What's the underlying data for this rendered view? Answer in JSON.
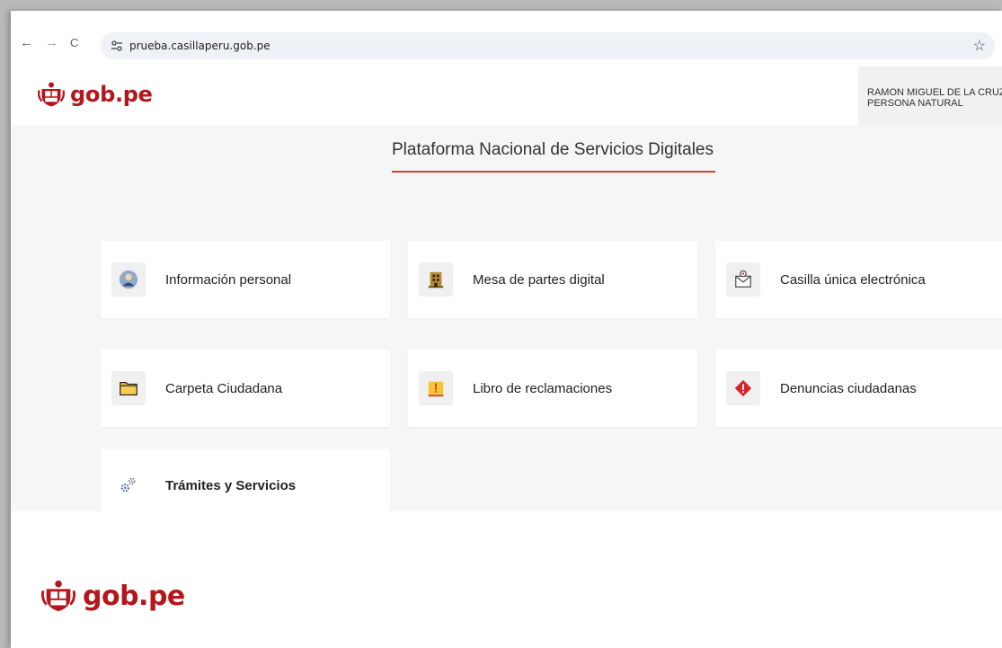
{
  "browser": {
    "url": "prueba.casillaperu.gob.pe",
    "back_glyph": "←",
    "forward_glyph": "→",
    "reload_glyph": "C",
    "star_glyph": "☆"
  },
  "header": {
    "logo_text": "gob.pe",
    "user_name": "RAMON MIGUEL DE LA CRUZ",
    "user_type": "PERSONA NATURAL"
  },
  "main": {
    "title": "Plataforma Nacional de Servicios Digitales",
    "cards": [
      {
        "label": "Información personal",
        "icon": "person-icon"
      },
      {
        "label": "Mesa de partes digital",
        "icon": "building-icon"
      },
      {
        "label": "Casilla única electrónica",
        "icon": "mail-icon"
      },
      {
        "label": "Carpeta Ciudadana",
        "icon": "folder-icon"
      },
      {
        "label": "Libro de reclamaciones",
        "icon": "complaint-book-icon"
      },
      {
        "label": "Denuncias ciudadanas",
        "icon": "alert-icon"
      },
      {
        "label": "Trámites y Servicios",
        "icon": "gears-icon"
      }
    ]
  },
  "footer": {
    "logo_text": "gob.pe"
  },
  "colors": {
    "brand_red": "#b4161b",
    "accent_underline": "#d0432f",
    "main_background": "#f6f6f6"
  }
}
